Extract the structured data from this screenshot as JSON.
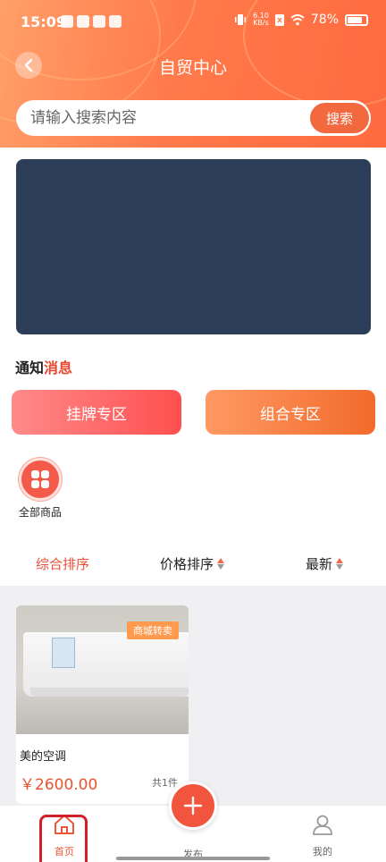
{
  "status_bar": {
    "time": "15:09",
    "network_speed": "6.10",
    "network_unit": "KB/s",
    "battery": "78%"
  },
  "nav": {
    "title": "自贸中心"
  },
  "search": {
    "placeholder": "请输入搜索内容",
    "button_label": "搜索"
  },
  "notice": {
    "title_part1": "通知",
    "title_part2": "消息"
  },
  "zones": {
    "left_label": "挂牌专区",
    "right_label": "组合专区"
  },
  "categories": {
    "all_goods_label": "全部商品"
  },
  "sort": {
    "comprehensive": "综合排序",
    "price": "价格排序",
    "newest": "最新"
  },
  "products": [
    {
      "tag": "商城转卖",
      "name": "美的空调",
      "price": "￥2600.00",
      "count": "共1件"
    }
  ],
  "bottom_nav": {
    "home": "首页",
    "publish": "发布",
    "mine": "我的"
  },
  "colors": {
    "accent": "#f2683f",
    "banner": "#2c3e57",
    "price": "#e8542e"
  }
}
